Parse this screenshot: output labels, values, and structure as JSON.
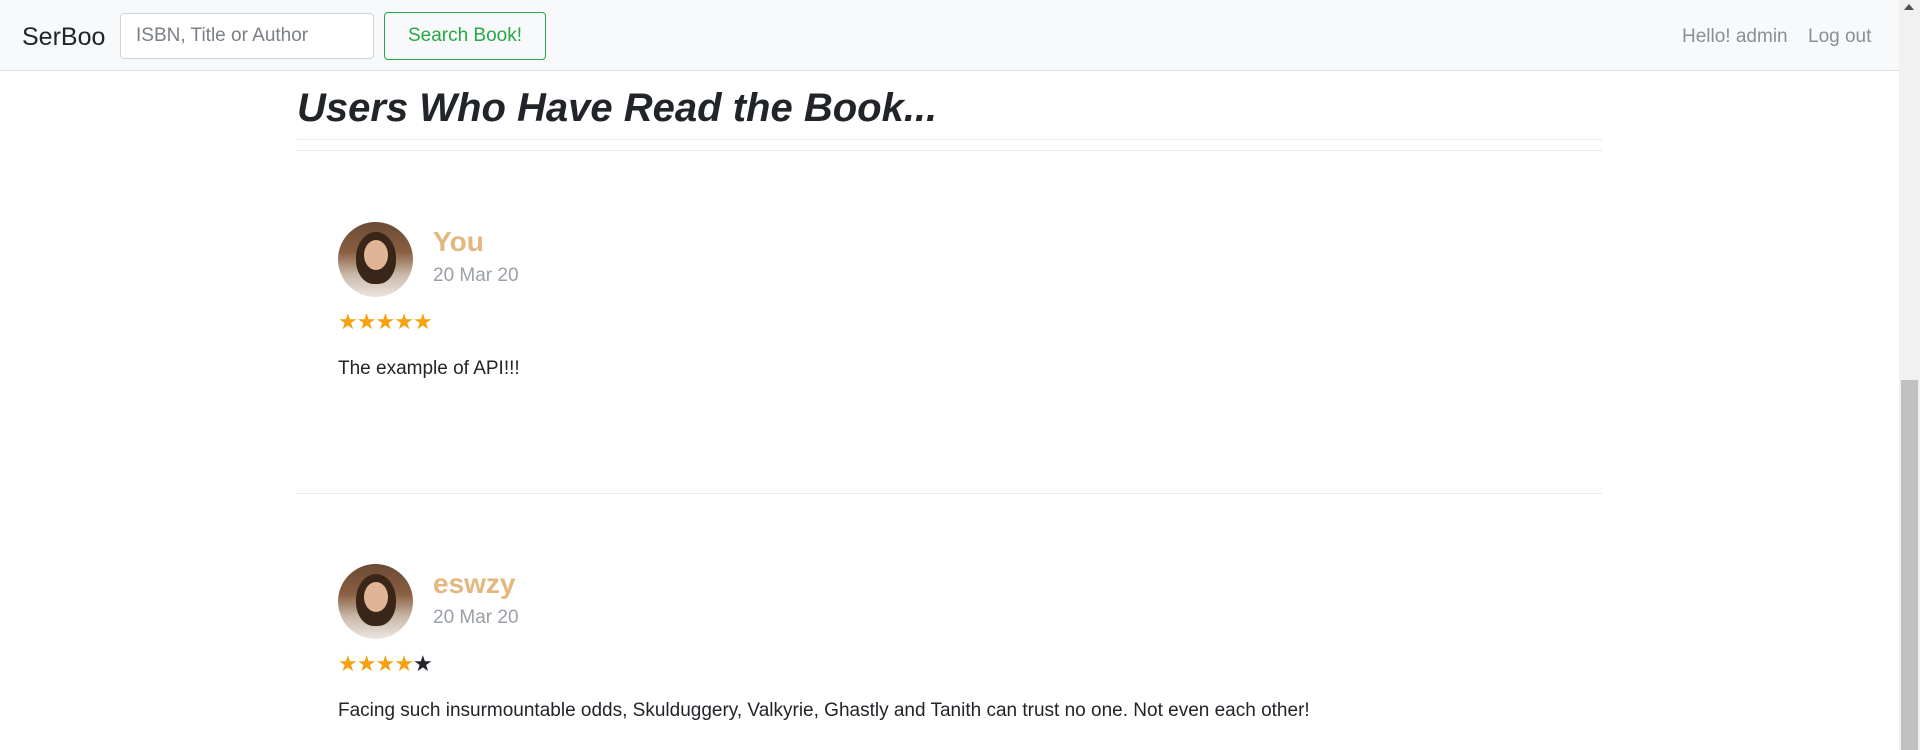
{
  "nav": {
    "brand": "SerBoo",
    "search_placeholder": "ISBN, Title or Author",
    "search_button": "Search Book!",
    "greeting": "Hello! admin",
    "logout": "Log out"
  },
  "section": {
    "title": "Users Who Have Read the Book..."
  },
  "reviews": [
    {
      "user": "You",
      "date": "20 Mar 20",
      "rating": 5,
      "rating_max": 5,
      "text": "The example of API!!!"
    },
    {
      "user": "eswzy",
      "date": "20 Mar 20",
      "rating": 4,
      "rating_max": 5,
      "text": "Facing such insurmountable odds, Skulduggery, Valkyrie, Ghastly and Tanith can trust no one. Not even each other!"
    }
  ],
  "colors": {
    "accent_green": "#28a745",
    "username": "#e3b77d",
    "star": "#f5a110"
  }
}
